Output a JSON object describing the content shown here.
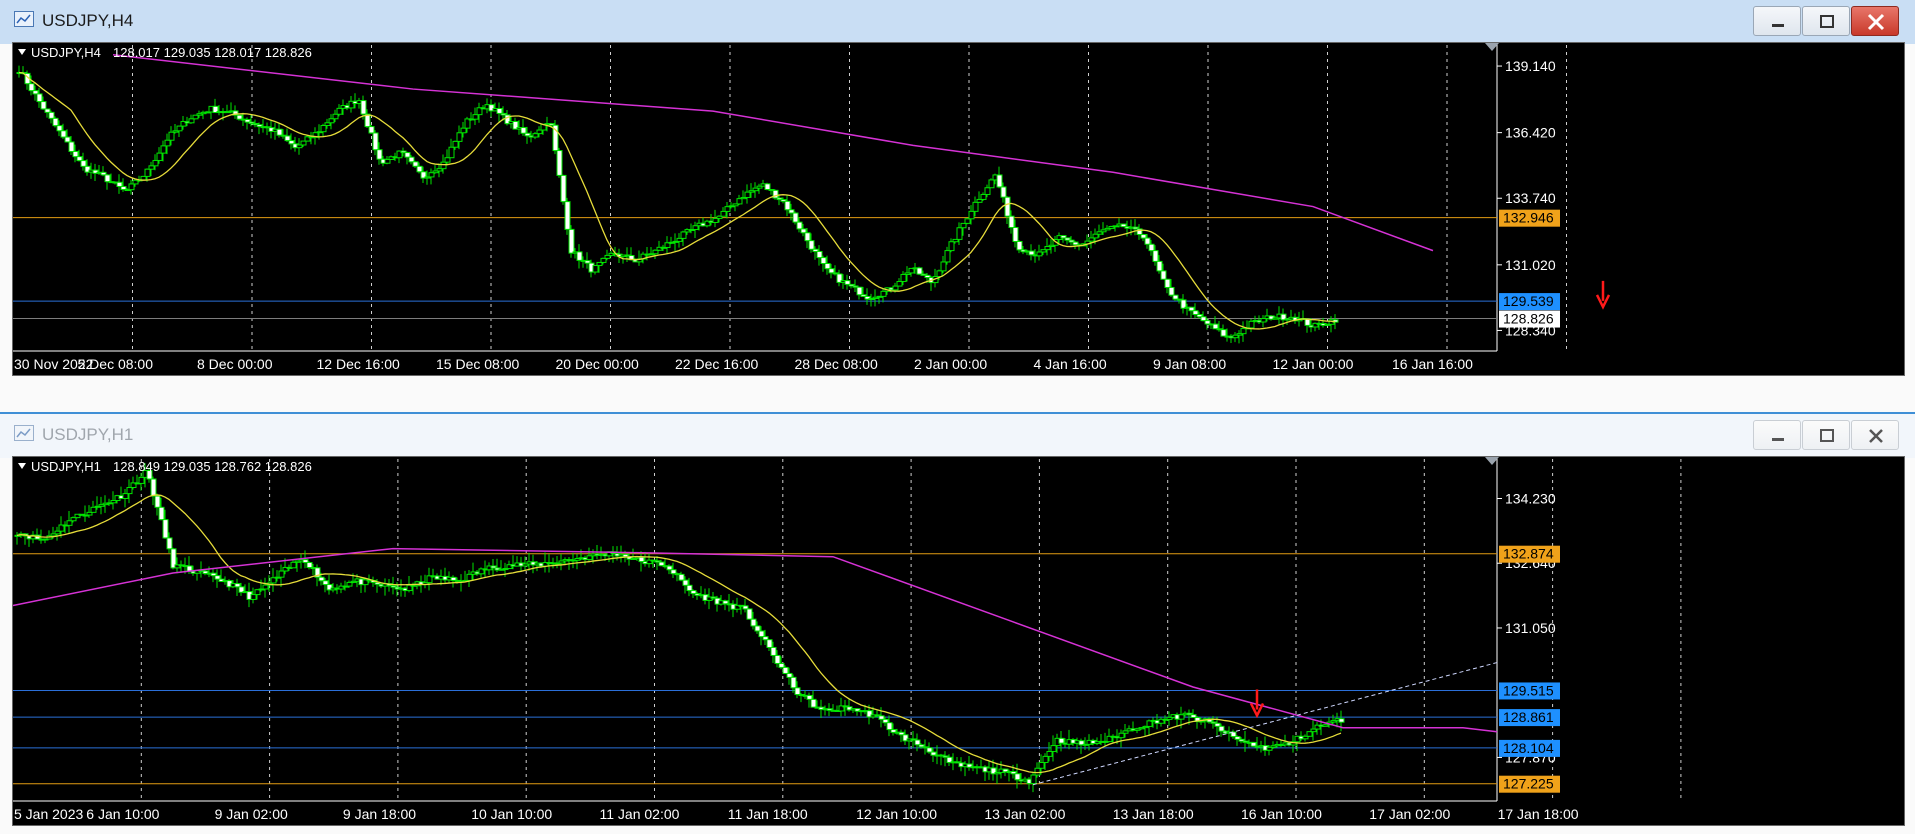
{
  "windows": [
    {
      "title": "USDJPY,H4",
      "header": {
        "symbol": "USDJPY,H4",
        "ohlc": "128.017 129.035 128.017 128.826"
      },
      "y_min": 127.5,
      "y_max": 140.0,
      "y_ticks": [
        "139.140",
        "136.420",
        "133.740",
        "131.020",
        "128.340"
      ],
      "y_tick_values": [
        139.14,
        136.42,
        133.74,
        131.02,
        128.34
      ],
      "x_labels": [
        "30 Nov 2022",
        "5 Dec 08:00",
        "8 Dec 00:00",
        "12 Dec 16:00",
        "15 Dec 08:00",
        "20 Dec 00:00",
        "22 Dec 16:00",
        "28 Dec 08:00",
        "2 Jan 00:00",
        "4 Jan 16:00",
        "9 Jan 08:00",
        "12 Jan 00:00",
        "16 Jan 16:00"
      ],
      "levels": [
        {
          "label": "132.946",
          "value": 132.946,
          "color": "#e39c12",
          "badge": "#f0a21a",
          "text_color": "#000000"
        },
        {
          "label": "129.539",
          "value": 129.539,
          "color": "#2b6fd8",
          "badge": "#1e90ff",
          "text_color": "#000000"
        },
        {
          "label": "128.826",
          "value": 128.826,
          "color": "#7d7d7d",
          "badge": "#ffffff",
          "text_color": "#000000"
        }
      ],
      "colors": {
        "bull": "#00e400",
        "bear": "#00e400",
        "fast_ma": "#e6dc3a",
        "slow_ma": "#d532d5",
        "grid": "#cfcfcf",
        "arrow": "#ff1a1a"
      }
    },
    {
      "title": "USDJPY,H1",
      "header": {
        "symbol": "USDJPY,H1",
        "ohlc": "128.849 129.035 128.762 128.826"
      },
      "y_min": 126.8,
      "y_max": 135.2,
      "y_ticks": [
        "134.230",
        "132.640",
        "131.050",
        "127.870"
      ],
      "y_tick_values": [
        134.23,
        132.64,
        131.05,
        127.87
      ],
      "x_labels": [
        "5 Jan 2023",
        "6 Jan 10:00",
        "9 Jan 02:00",
        "9 Jan 18:00",
        "10 Jan 10:00",
        "11 Jan 02:00",
        "11 Jan 18:00",
        "12 Jan 10:00",
        "13 Jan 02:00",
        "13 Jan 18:00",
        "16 Jan 10:00",
        "17 Jan 02:00",
        "17 Jan 18:00"
      ],
      "levels": [
        {
          "label": "132.874",
          "value": 132.874,
          "color": "#e39c12",
          "badge": "#f0a21a",
          "text_color": "#000000"
        },
        {
          "label": "129.515",
          "value": 129.515,
          "color": "#2b6fd8",
          "badge": "#1e90ff",
          "text_color": "#000000"
        },
        {
          "label": "128.861",
          "value": 128.861,
          "color": "#2b6fd8",
          "badge": "#1e90ff",
          "text_color": "#000000"
        },
        {
          "label": "128.104",
          "value": 128.104,
          "color": "#2b6fd8",
          "badge": "#1e90ff",
          "text_color": "#000000"
        },
        {
          "label": "127.225",
          "value": 127.225,
          "color": "#e39c12",
          "badge": "#f0a21a",
          "text_color": "#000000"
        }
      ],
      "colors": {
        "bull": "#00e400",
        "bear": "#00e400",
        "fast_ma": "#e6dc3a",
        "slow_ma": "#d532d5",
        "grid": "#cfcfcf",
        "arrow": "#ff1a1a"
      }
    }
  ],
  "chart_data": [
    {
      "type": "candlestick",
      "title": "USDJPY,H4",
      "x_labels": [
        "30 Nov 2022",
        "5 Dec 08:00",
        "8 Dec 00:00",
        "12 Dec 16:00",
        "15 Dec 08:00",
        "20 Dec 00:00",
        "22 Dec 16:00",
        "28 Dec 08:00",
        "2 Jan 00:00",
        "4 Jan 16:00",
        "9 Jan 08:00",
        "12 Jan 00:00",
        "16 Jan 16:00"
      ],
      "ylim": [
        127.5,
        140.0
      ],
      "close_path": [
        139.0,
        137.6,
        136.3,
        135.0,
        134.6,
        134.0,
        134.8,
        136.2,
        137.0,
        137.4,
        137.2,
        136.8,
        136.5,
        135.8,
        136.4,
        137.3,
        137.8,
        135.2,
        135.6,
        134.6,
        135.2,
        136.8,
        137.6,
        136.9,
        136.2,
        137.0,
        131.6,
        130.8,
        131.5,
        131.2,
        131.6,
        132.1,
        132.6,
        133.0,
        133.8,
        134.3,
        133.6,
        132.2,
        130.8,
        130.2,
        129.7,
        130.0,
        130.9,
        130.3,
        132.0,
        133.5,
        134.7,
        131.8,
        131.4,
        132.1,
        131.8,
        132.4,
        132.6,
        132.2,
        130.1,
        129.2,
        128.6,
        128.0,
        128.6,
        128.9,
        128.9,
        128.5,
        128.8
      ]
    },
    {
      "type": "candlestick",
      "title": "USDJPY,H1",
      "x_labels": [
        "5 Jan 2023",
        "6 Jan 10:00",
        "9 Jan 02:00",
        "9 Jan 18:00",
        "10 Jan 10:00",
        "11 Jan 02:00",
        "11 Jan 18:00",
        "12 Jan 10:00",
        "13 Jan 02:00",
        "13 Jan 18:00",
        "16 Jan 10:00",
        "17 Jan 02:00",
        "17 Jan 18:00"
      ],
      "ylim": [
        126.8,
        135.2
      ],
      "close_path": [
        133.4,
        133.2,
        133.7,
        134.0,
        134.3,
        134.9,
        132.6,
        132.4,
        132.2,
        131.8,
        132.3,
        132.8,
        132.0,
        132.2,
        132.1,
        132.0,
        132.3,
        132.2,
        132.5,
        132.6,
        132.6,
        132.7,
        132.8,
        132.9,
        132.7,
        132.6,
        131.9,
        131.7,
        131.5,
        130.5,
        129.5,
        129.0,
        129.1,
        128.9,
        128.4,
        128.1,
        127.7,
        127.6,
        127.5,
        127.3,
        128.3,
        128.2,
        128.3,
        128.6,
        128.8,
        128.9,
        128.7,
        128.3,
        128.1,
        128.2,
        128.6,
        128.8
      ]
    }
  ]
}
